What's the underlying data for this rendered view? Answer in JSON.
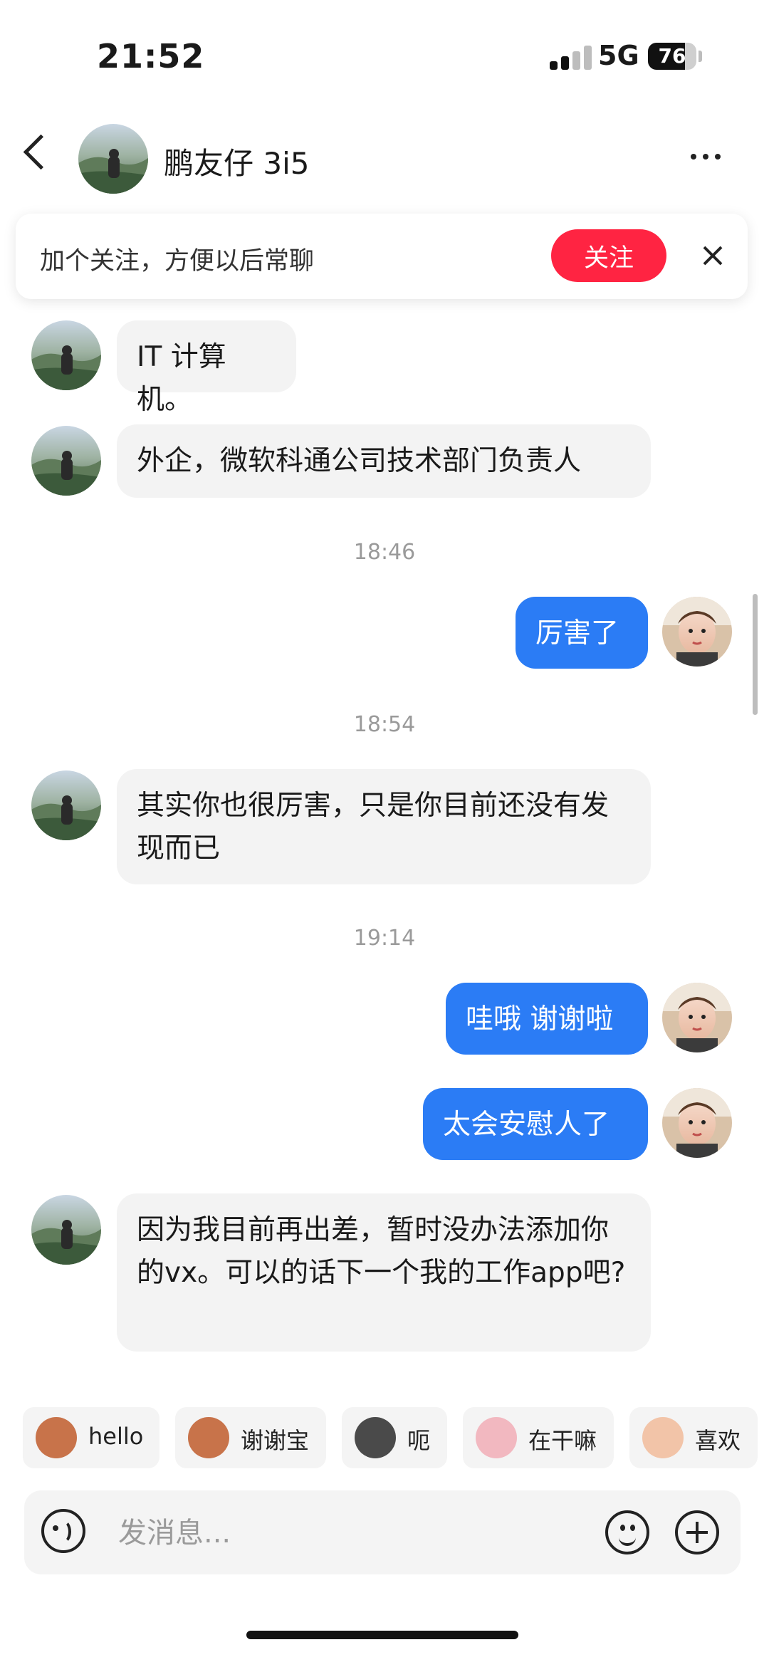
{
  "status_bar": {
    "time": "21:52",
    "network": "5G",
    "battery": "76"
  },
  "header": {
    "contact_name": "鹏友仔 3i5"
  },
  "follow_banner": {
    "text": "加个关注，方便以后常聊",
    "button": "关注"
  },
  "messages": [
    {
      "from": "contact",
      "text": "IT 计算机。"
    },
    {
      "from": "contact",
      "text": "外企，微软科通公司技术部门负责人"
    },
    {
      "type": "timestamp",
      "text": "18:46"
    },
    {
      "from": "me",
      "text": "厉害了"
    },
    {
      "type": "timestamp",
      "text": "18:54"
    },
    {
      "from": "contact",
      "text": "其实你也很厉害，只是你目前还没有发现而已"
    },
    {
      "type": "timestamp",
      "text": "19:14"
    },
    {
      "from": "me",
      "text": "哇哦 谢谢啦"
    },
    {
      "from": "me",
      "text": "太会安慰人了"
    },
    {
      "from": "contact",
      "text": "因为我目前再出差，暂时没办法添加你的vx。可以的话下一个我的工作app吧?"
    }
  ],
  "quick_replies": [
    {
      "label": "hello",
      "icon": "monkey-sticker-icon"
    },
    {
      "label": "谢谢宝",
      "icon": "monkey-flower-sticker-icon"
    },
    {
      "label": "呃",
      "icon": "cat-sticker-icon"
    },
    {
      "label": "在干嘛",
      "icon": "pig-sticker-icon"
    },
    {
      "label": "喜欢",
      "icon": "pig-heart-sticker-icon"
    }
  ],
  "input": {
    "placeholder": "发消息..."
  },
  "colors": {
    "accent_red": "#ff2442",
    "outgoing_bubble": "#2b7cf5",
    "incoming_bubble": "#f3f3f3"
  }
}
